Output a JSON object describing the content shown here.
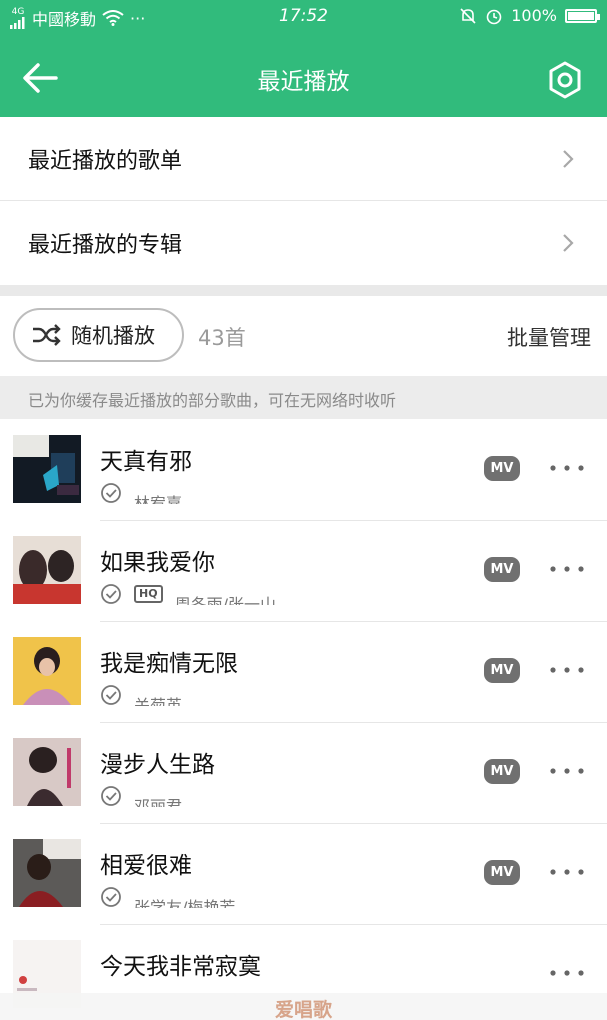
{
  "status_bar": {
    "network_type": "4G",
    "carrier": "中國移動",
    "more": "···",
    "time": "17:52",
    "battery": "100%",
    "battery_level": 1.0
  },
  "nav": {
    "title": "最近播放"
  },
  "menu": [
    {
      "label": "最近播放的歌单"
    },
    {
      "label": "最近播放的专辑"
    }
  ],
  "controls": {
    "shuffle_label": "随机播放",
    "count": "43首",
    "batch_label": "批量管理"
  },
  "cache_note": "已为你缓存最近播放的部分歌曲，可在无网络时收听",
  "songs": [
    {
      "title": "天真有邪",
      "artist": "林宥嘉",
      "hq": "",
      "mv": "MV"
    },
    {
      "title": "如果我爱你",
      "artist": "周冬雨/张一山",
      "hq": "HQ",
      "mv": "MV"
    },
    {
      "title": "我是痴情无限",
      "artist": "关菊英",
      "hq": "",
      "mv": "MV"
    },
    {
      "title": "漫步人生路",
      "artist": "邓丽君",
      "hq": "",
      "mv": "MV"
    },
    {
      "title": "相爱很难",
      "artist": "张学友/梅艳芳",
      "hq": "",
      "mv": "MV"
    },
    {
      "title": "今天我非常寂寞",
      "artist": "",
      "hq": "",
      "mv": ""
    }
  ],
  "watermark": "爱唱歌",
  "colors": {
    "header": "#31bb7c",
    "mv_badge": "#707070"
  }
}
